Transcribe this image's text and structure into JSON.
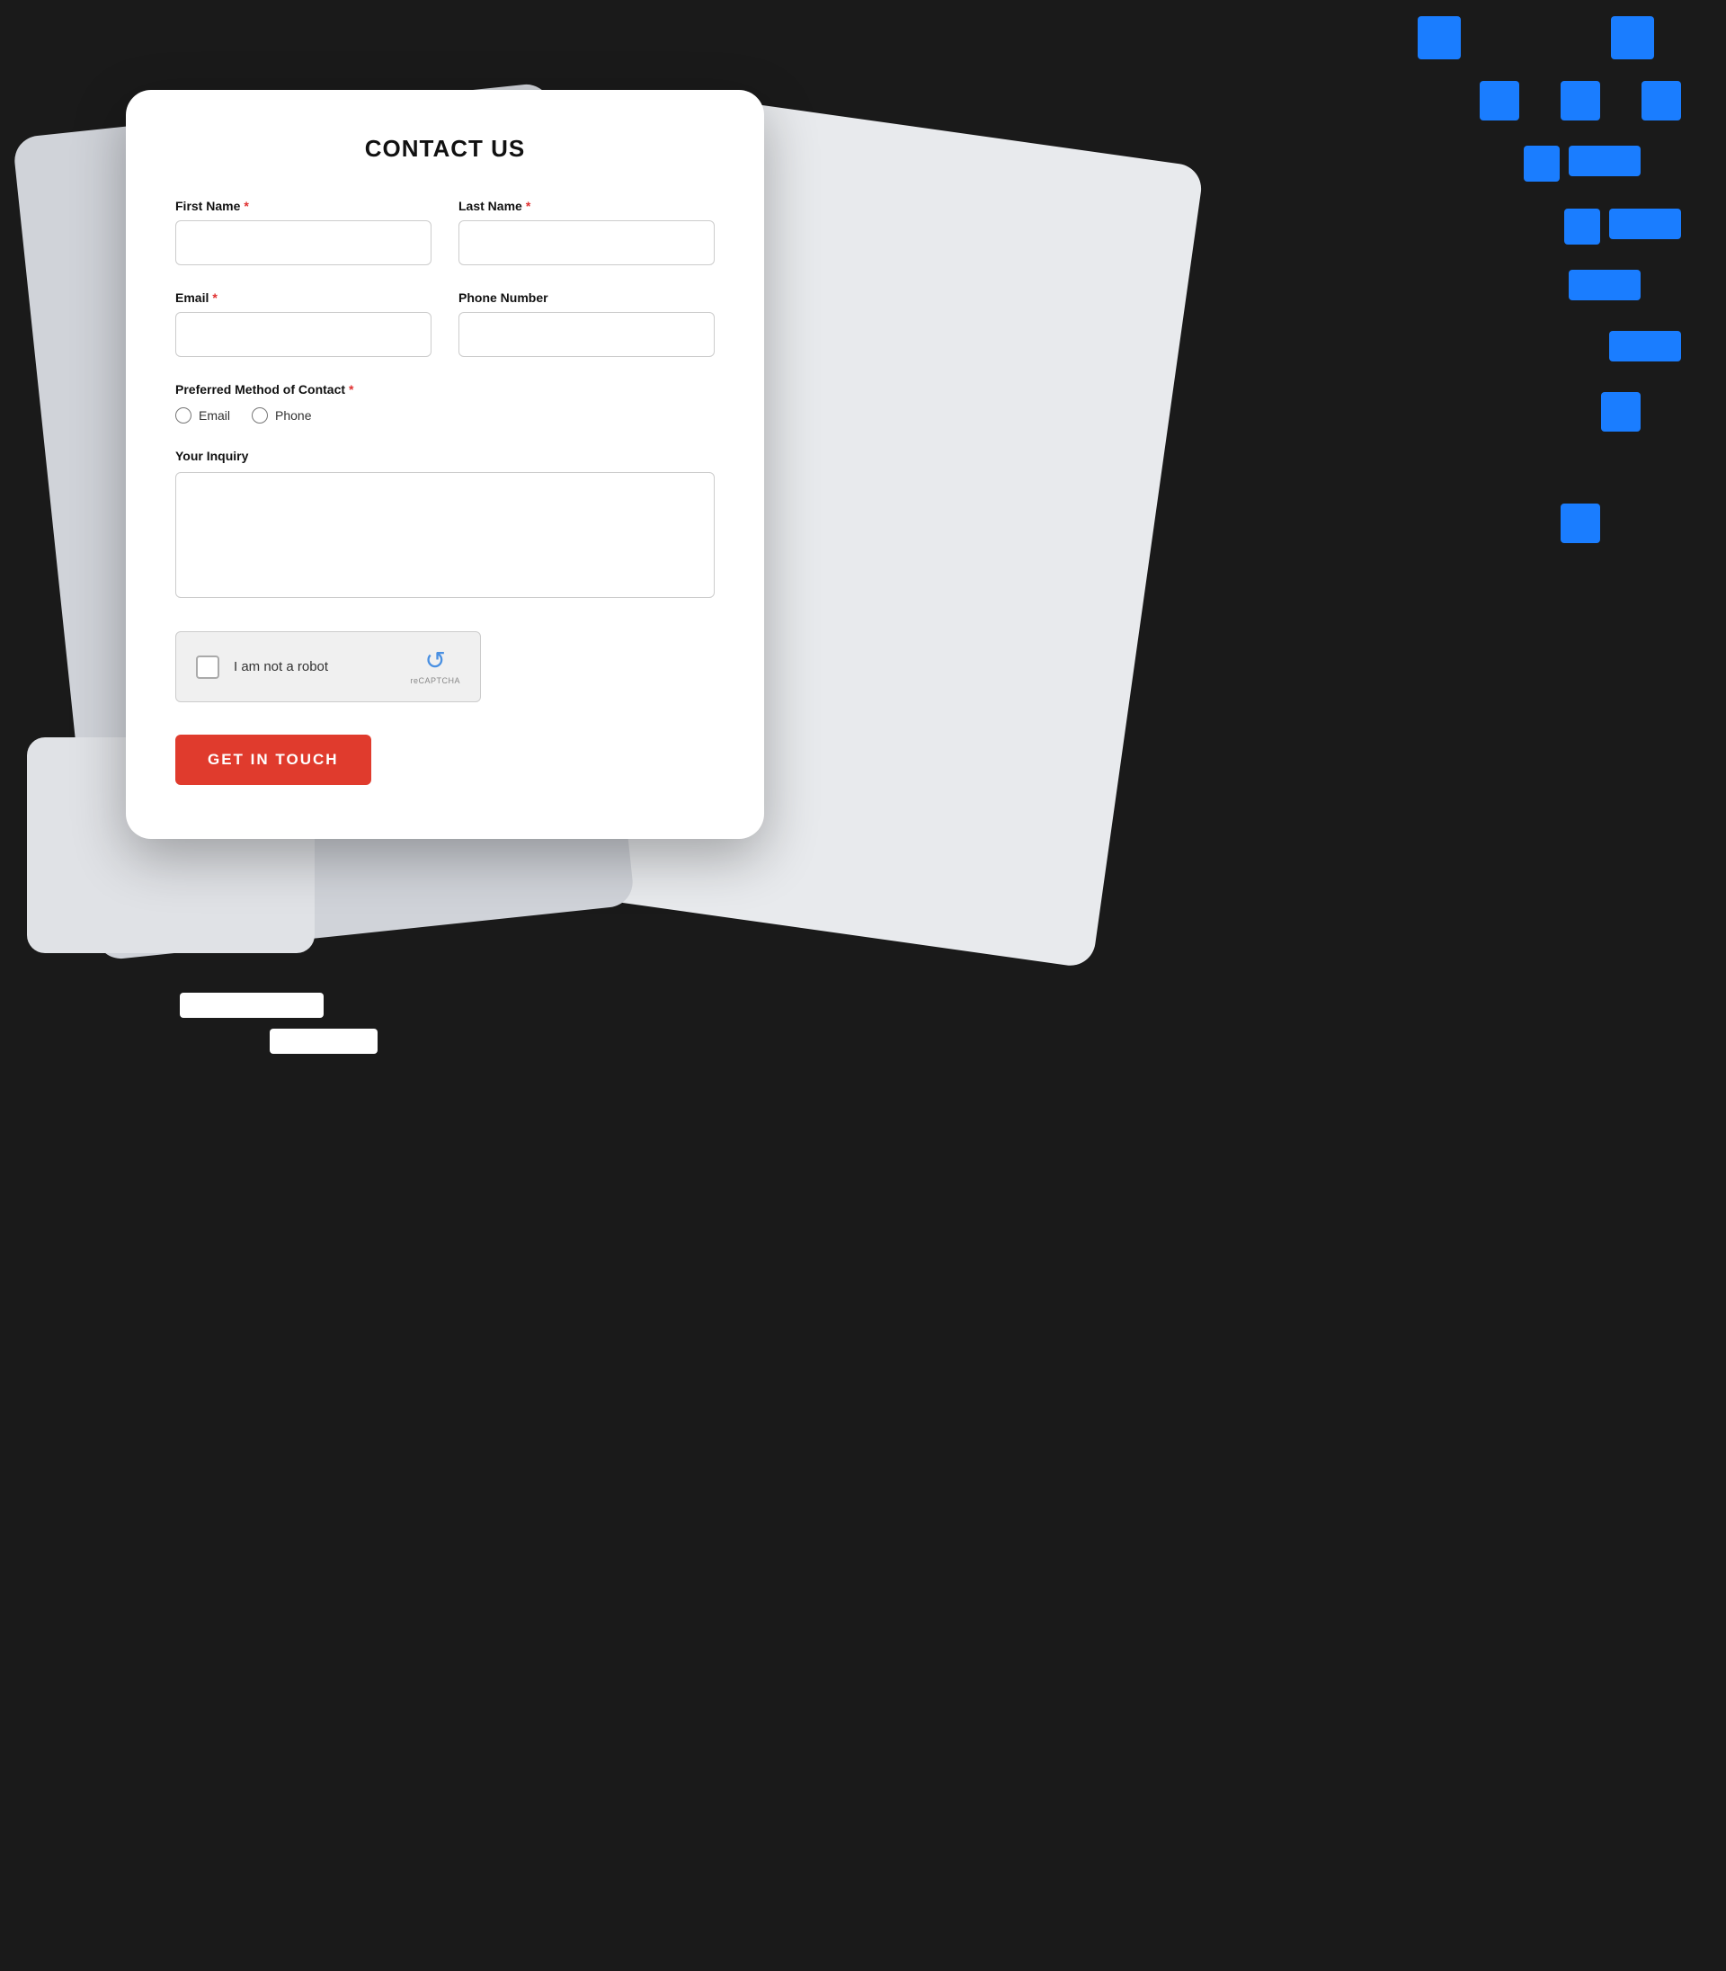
{
  "page": {
    "background_color": "#1a1a1a"
  },
  "form": {
    "title": "CONTACT US",
    "fields": {
      "first_name": {
        "label": "First Name",
        "required": true,
        "placeholder": ""
      },
      "last_name": {
        "label": "Last Name",
        "required": true,
        "placeholder": ""
      },
      "email": {
        "label": "Email",
        "required": true,
        "placeholder": ""
      },
      "phone_number": {
        "label": "Phone Number",
        "required": false,
        "placeholder": ""
      }
    },
    "preferred_contact": {
      "label": "Preferred Method of Contact",
      "required": true,
      "options": [
        "Email",
        "Phone"
      ]
    },
    "inquiry": {
      "label": "Your Inquiry",
      "placeholder": ""
    },
    "recaptcha": {
      "text": "I am not a robot",
      "caption": "reCAPTCHA"
    },
    "submit_button": "GET IN TOUCH"
  },
  "decorative": {
    "blue_color": "#1a7dff",
    "required_color": "#e03030",
    "button_color": "#e03b2d"
  }
}
